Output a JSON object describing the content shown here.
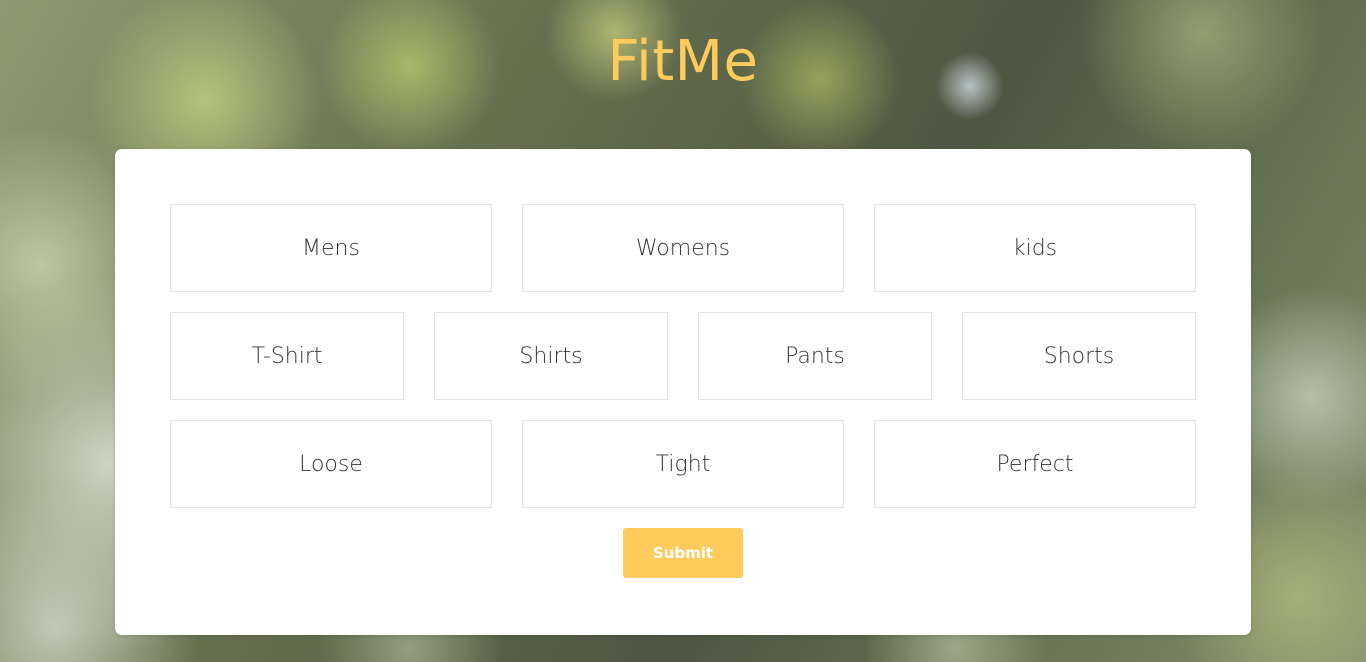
{
  "brand": {
    "title": "FitMe",
    "accent_color": "#fecb5c"
  },
  "form": {
    "category_options": [
      "Mens",
      "Womens",
      "kids"
    ],
    "type_options": [
      "T-Shirt",
      "Shirts",
      "Pants",
      "Shorts"
    ],
    "fit_options": [
      "Loose",
      "Tight",
      "Perfect"
    ],
    "submit_label": "Submit"
  }
}
